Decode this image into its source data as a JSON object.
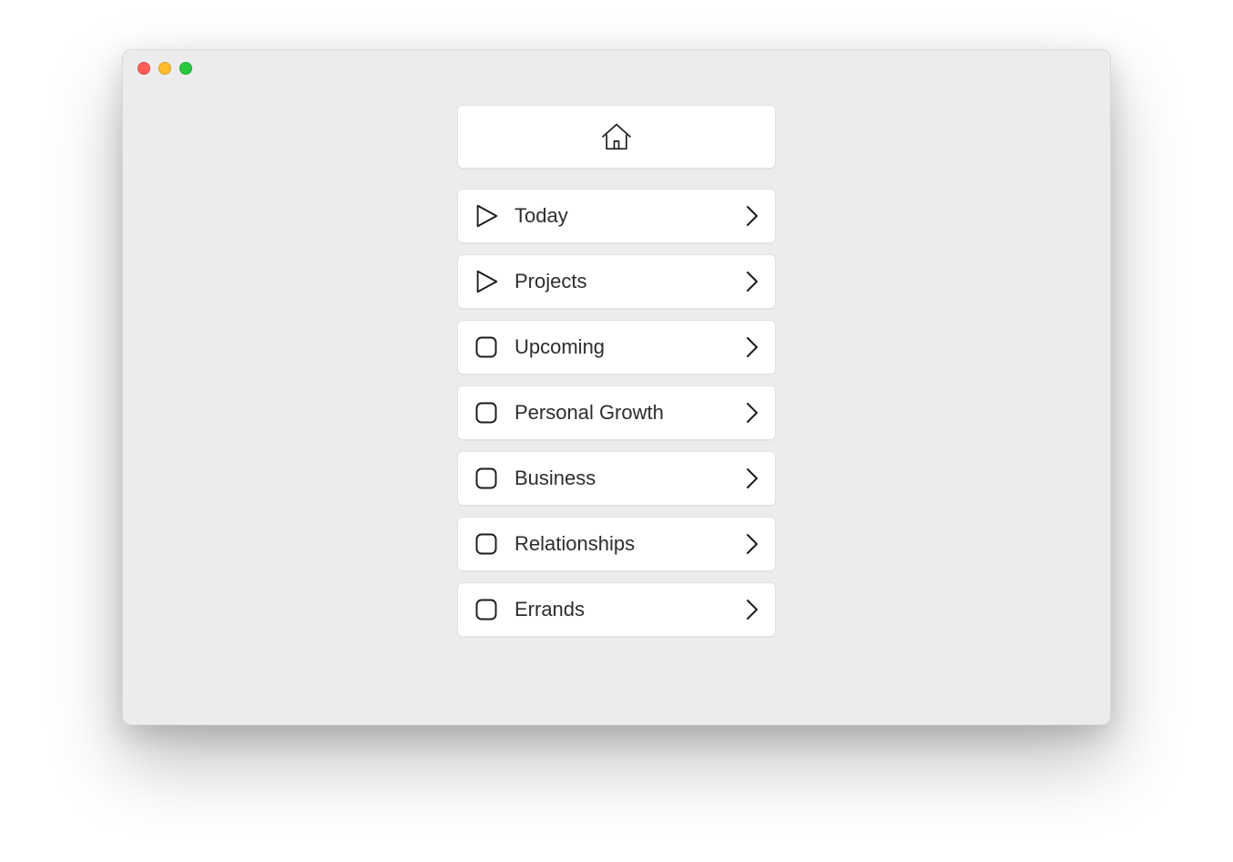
{
  "nav": {
    "items": [
      {
        "id": "today",
        "label": "Today",
        "icon": "play"
      },
      {
        "id": "projects",
        "label": "Projects",
        "icon": "play"
      },
      {
        "id": "upcoming",
        "label": "Upcoming",
        "icon": "square"
      },
      {
        "id": "personal-growth",
        "label": "Personal Growth",
        "icon": "square"
      },
      {
        "id": "business",
        "label": "Business",
        "icon": "square"
      },
      {
        "id": "relationships",
        "label": "Relationships",
        "icon": "square"
      },
      {
        "id": "errands",
        "label": "Errands",
        "icon": "square"
      }
    ]
  }
}
